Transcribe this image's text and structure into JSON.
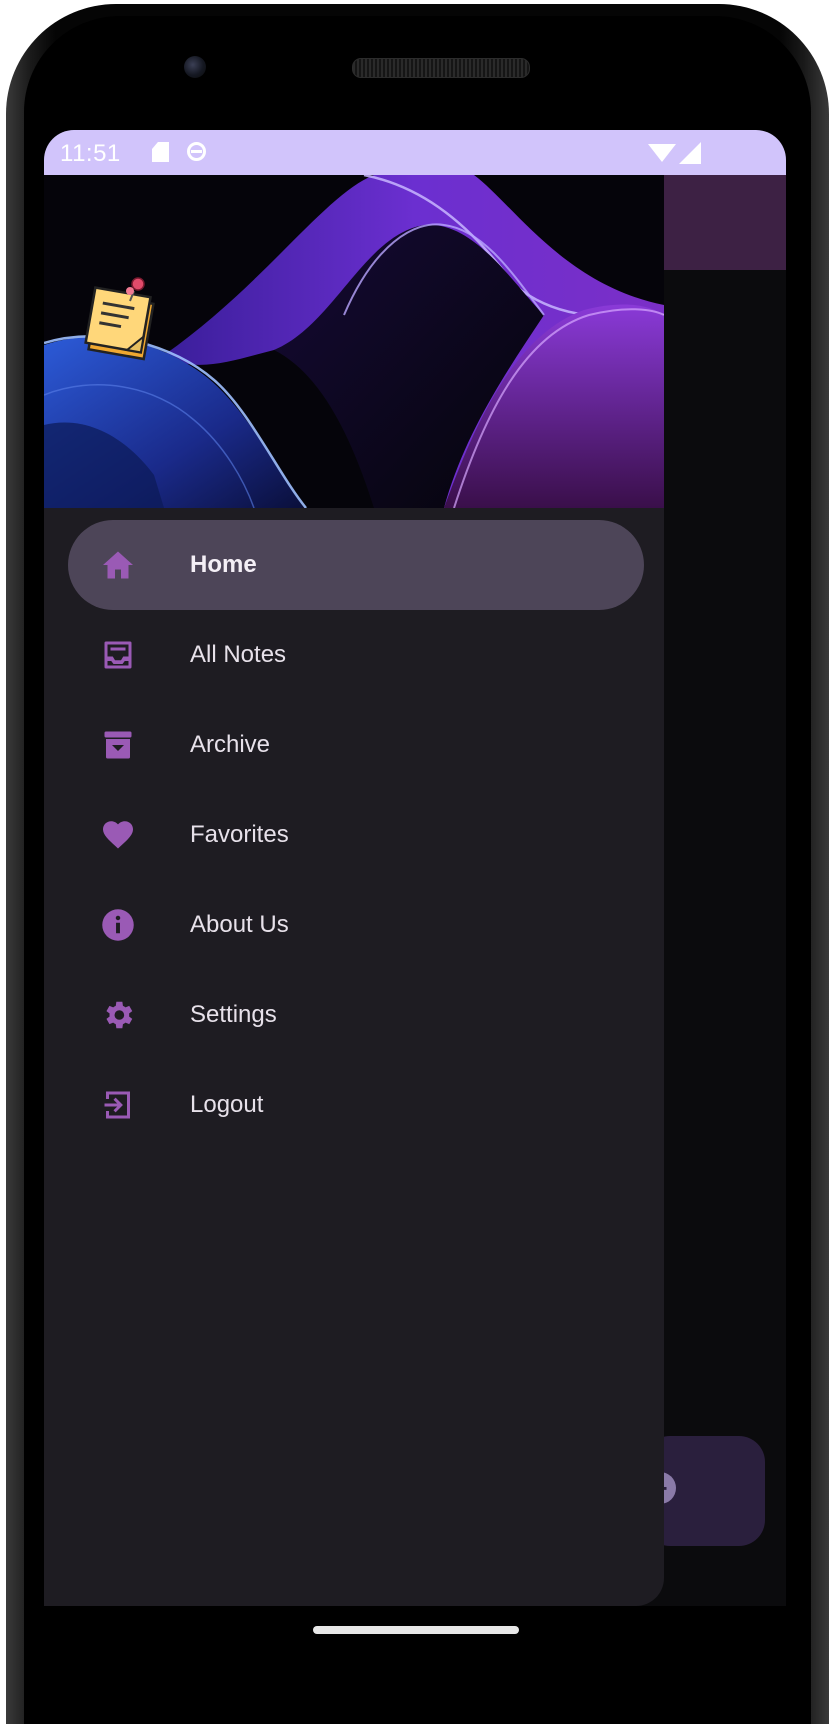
{
  "status_bar": {
    "time": "11:51",
    "icons": [
      "sd-card-icon",
      "debug-icon",
      "wifi-icon",
      "signal-icon"
    ]
  },
  "drawer": {
    "header_logo": "sticky-note-icon",
    "items": [
      {
        "label": "Home",
        "icon": "home-icon",
        "active": true
      },
      {
        "label": "All Notes",
        "icon": "inbox-icon",
        "active": false
      },
      {
        "label": "Archive",
        "icon": "archive-icon",
        "active": false
      },
      {
        "label": "Favorites",
        "icon": "heart-icon",
        "active": false
      },
      {
        "label": "About Us",
        "icon": "info-icon",
        "active": false
      },
      {
        "label": "Settings",
        "icon": "gear-icon",
        "active": false
      },
      {
        "label": "Logout",
        "icon": "logout-icon",
        "active": false
      }
    ]
  },
  "colors": {
    "status_bar": "#d1c4fb",
    "drawer_bg": "#1e1c22",
    "active_item_bg": "#4d4558",
    "icon_accent": "#9a5ab5",
    "app_bar_behind": "#3d2144",
    "fab_behind": "#2a1f3d"
  }
}
